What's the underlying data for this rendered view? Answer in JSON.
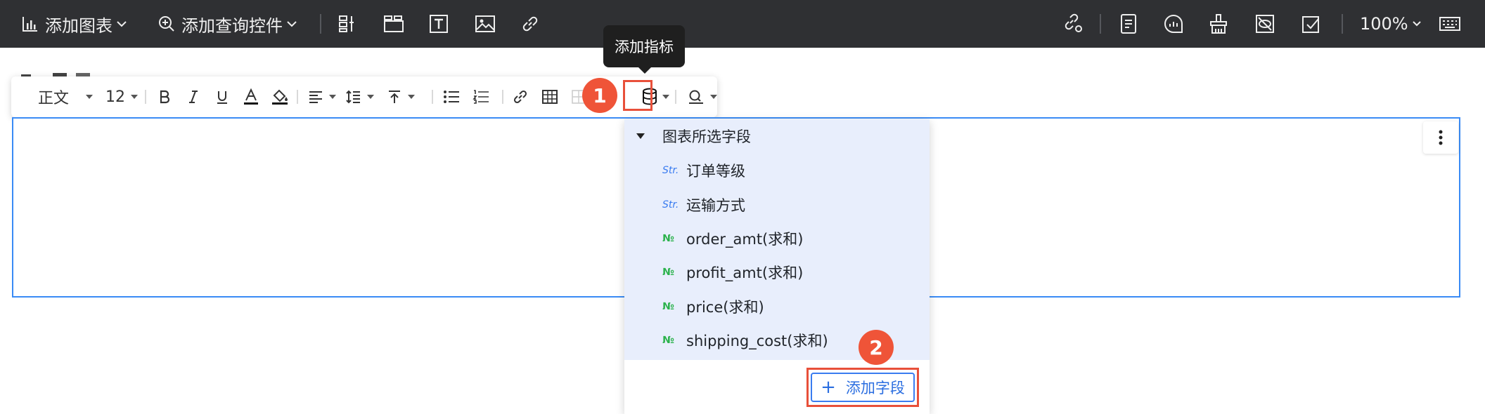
{
  "topbar": {
    "add_chart": "添加图表",
    "add_query_control": "添加查询控件",
    "zoom": "100%"
  },
  "tooltip": {
    "text": "添加指标"
  },
  "rich_toolbar": {
    "paragraph_style": "正文",
    "font_size": "12"
  },
  "dropdown": {
    "group_title": "图表所选字段",
    "fields": [
      {
        "type": "Str.",
        "label": "订单等级"
      },
      {
        "type": "Str.",
        "label": "运输方式"
      },
      {
        "type": "№",
        "label": "order_amt(求和)"
      },
      {
        "type": "№",
        "label": "profit_amt(求和)"
      },
      {
        "type": "№",
        "label": "price(求和)"
      },
      {
        "type": "№",
        "label": "shipping_cost(求和)"
      }
    ],
    "add_field_label": "添加字段",
    "add_field_icon": "+"
  },
  "annotations": {
    "badge1": "1",
    "badge2": "2"
  },
  "colors": {
    "topbar_bg": "#2f3033",
    "accent_blue": "#3a8bf5",
    "annotation_red": "#ef5438",
    "list_bg": "#e8eefc"
  }
}
